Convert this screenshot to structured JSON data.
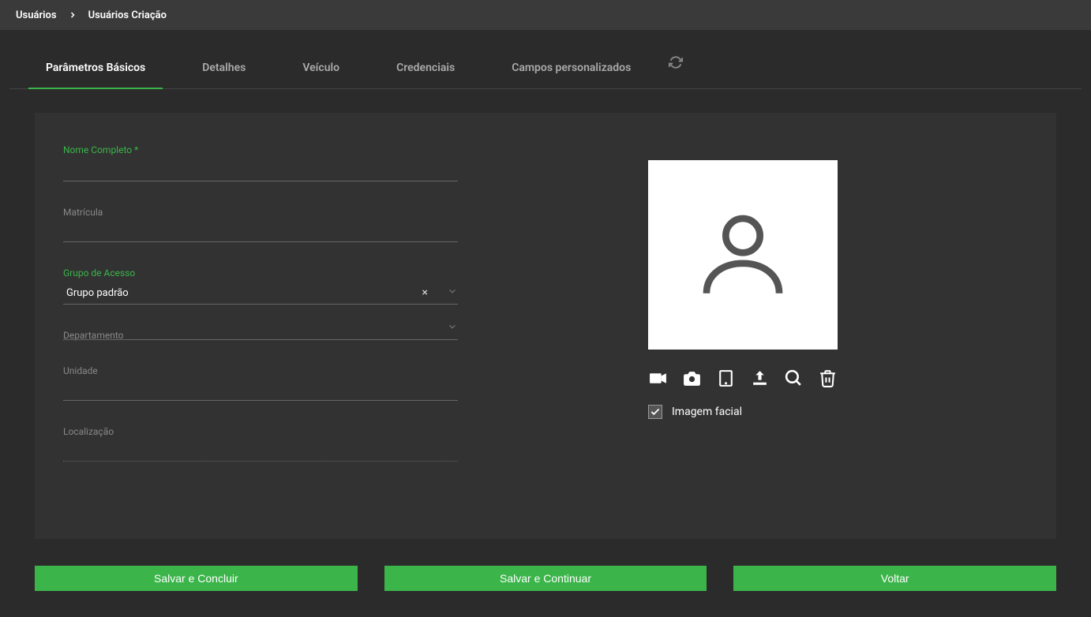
{
  "breadcrumb": {
    "root": "Usuários",
    "current": "Usuários Criação"
  },
  "tabs": [
    {
      "label": "Parâmetros Básicos",
      "active": true
    },
    {
      "label": "Detalhes"
    },
    {
      "label": "Veículo"
    },
    {
      "label": "Credenciais"
    },
    {
      "label": "Campos personalizados"
    }
  ],
  "form": {
    "nome_label": "Nome Completo",
    "nome_value": "",
    "matricula_label": "Matrícula",
    "matricula_value": "",
    "grupo_label": "Grupo de Acesso",
    "grupo_selected": "Grupo padrão",
    "departamento_label": "Departamento",
    "departamento_value": "",
    "unidade_label": "Unidade",
    "unidade_value": "",
    "localizacao_label": "Localização",
    "localizacao_value": ""
  },
  "photo": {
    "facial_checkbox_label": "Imagem facial",
    "facial_checked": true
  },
  "buttons": {
    "save_finish": "Salvar e Concluir",
    "save_continue": "Salvar e Continuar",
    "back": "Voltar"
  }
}
